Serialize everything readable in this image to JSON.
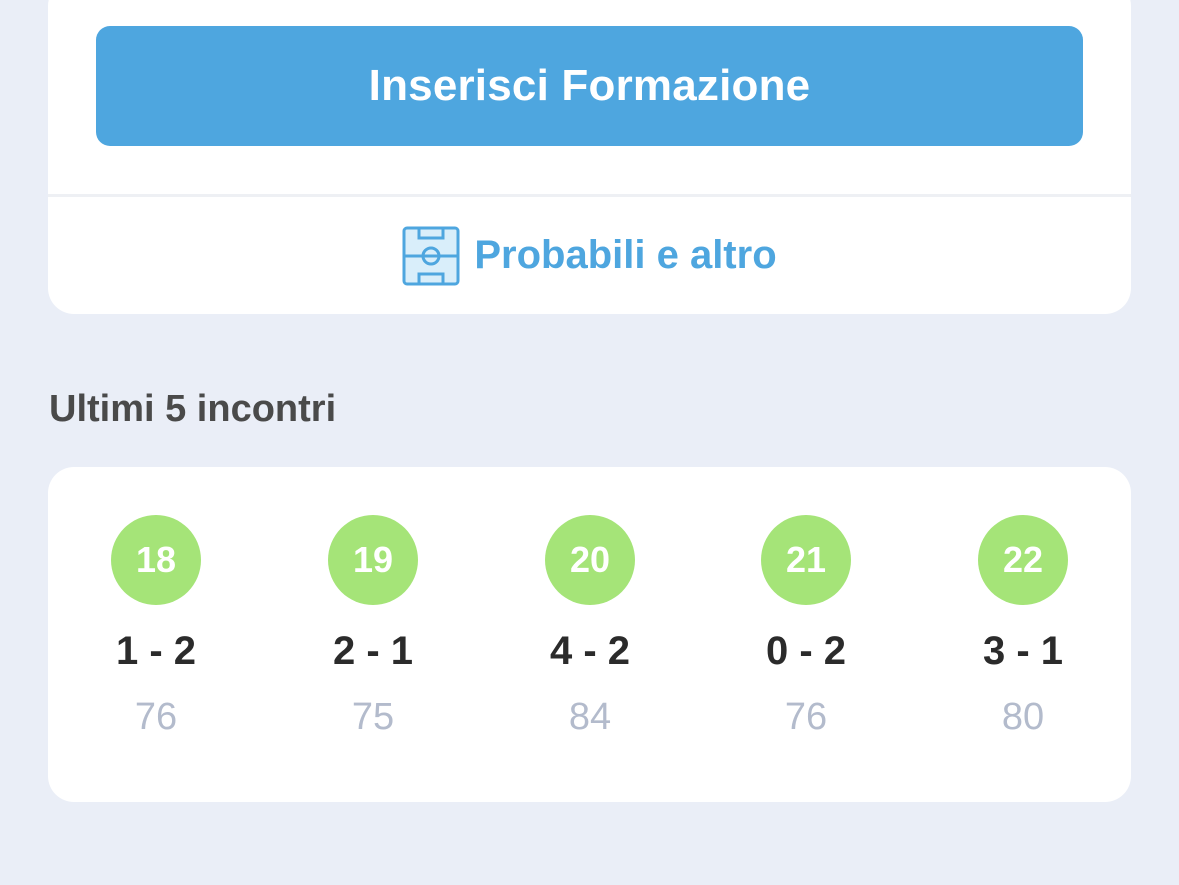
{
  "formation": {
    "button_label": "Inserisci Formazione",
    "link_label": "Probabili e altro",
    "link_icon": "soccer-field-icon"
  },
  "last_matches": {
    "title": "Ultimi 5 incontri",
    "items": [
      {
        "round": "18",
        "score": "1 - 2",
        "points": "76"
      },
      {
        "round": "19",
        "score": "2 - 1",
        "points": "75"
      },
      {
        "round": "20",
        "score": "4 - 2",
        "points": "84"
      },
      {
        "round": "21",
        "score": "0 - 2",
        "points": "76"
      },
      {
        "round": "22",
        "score": "3 - 1",
        "points": "80"
      }
    ]
  },
  "colors": {
    "accent": "#4ea6df",
    "badge": "#a5e478",
    "background": "#eaeef7"
  }
}
